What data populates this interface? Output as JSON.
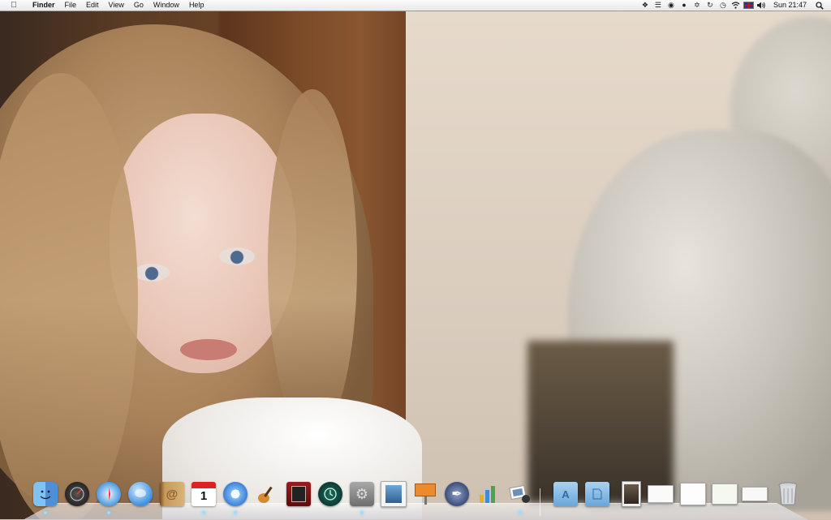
{
  "menubar": {
    "apple_icon": "",
    "app_name": "Finder",
    "menus": [
      "File",
      "Edit",
      "View",
      "Go",
      "Window",
      "Help"
    ],
    "status_icons": [
      "dropbox-icon",
      "cell-signal-icon",
      "growl-icon",
      "alien-icon",
      "bluetooth-icon",
      "sync-icon",
      "time-machine-icon",
      "wifi-icon",
      "uk-flag-icon",
      "volume-icon"
    ],
    "clock": "Sun 21:47",
    "spotlight_icon": "spotlight-icon"
  },
  "desktop": {
    "wallpaper": "photo-child-portrait"
  },
  "dock": {
    "apps": [
      "finder",
      "dashboard",
      "safari",
      "ichat",
      "address-book",
      "ical",
      "itunes",
      "garageband",
      "photo-booth",
      "time-machine",
      "system-preferences",
      "preview",
      "keynote",
      "directory-utility",
      "numbers",
      "iphoto"
    ],
    "calendar_day": "1",
    "folders": [
      "applications-folder",
      "documents-folder",
      "image-stack",
      "window-1",
      "window-2",
      "window-3",
      "window-4"
    ],
    "trash": "trash"
  },
  "colors": {
    "menubar_bg": "#f0f0f0",
    "accent": "#2a7fd8",
    "folder": "#7eb6e0"
  }
}
